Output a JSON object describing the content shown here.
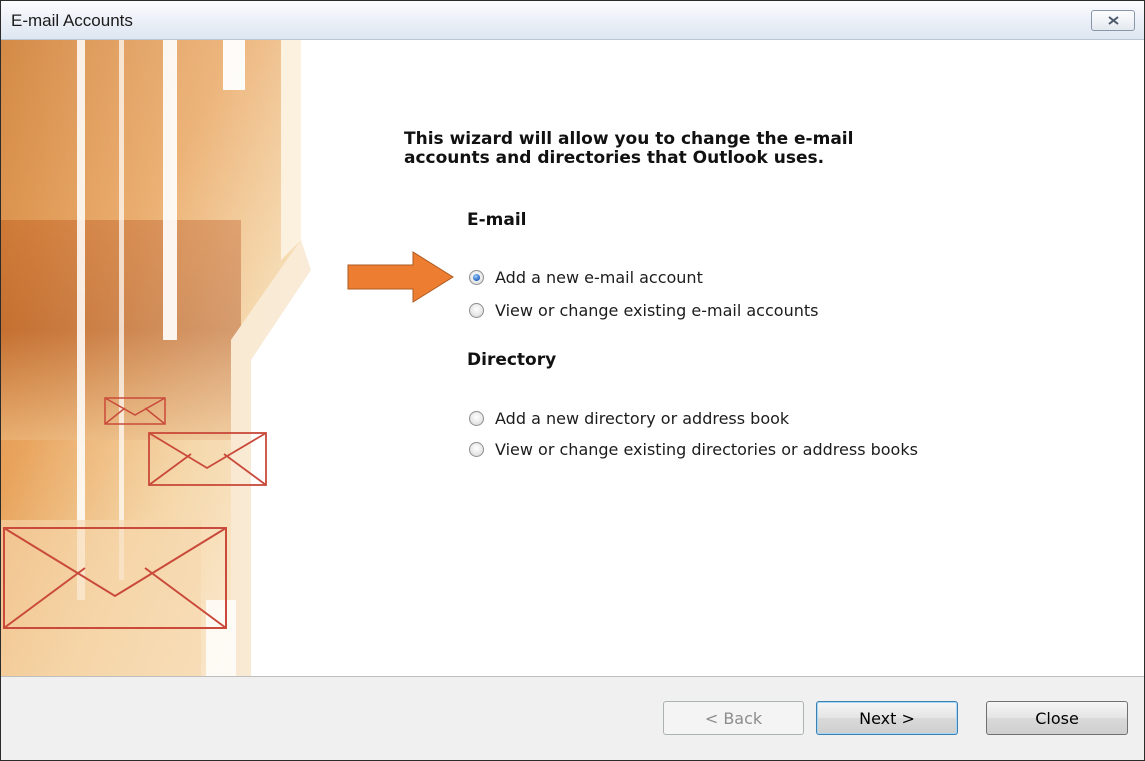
{
  "window": {
    "title": "E-mail Accounts"
  },
  "intro": {
    "line1": "This wizard will allow you to change the e-mail",
    "line2": "accounts and directories that Outlook uses."
  },
  "email_section": {
    "heading": "E-mail",
    "options": [
      {
        "label": "Add a new e-mail account",
        "checked": true
      },
      {
        "label": "View or change existing e-mail accounts",
        "checked": false
      }
    ]
  },
  "directory_section": {
    "heading": "Directory",
    "options": [
      {
        "label": "Add a new directory or address book",
        "checked": false
      },
      {
        "label": "View or change existing directories or address books",
        "checked": false
      }
    ]
  },
  "buttons": {
    "back": "< Back",
    "next": "Next >",
    "close": "Close"
  },
  "colors": {
    "accent_arrow": "#ed7d31",
    "banner_orange": "#d8832f"
  },
  "icons": {
    "close": "close-x-icon",
    "pointer": "arrow-right-icon",
    "envelope": "envelope-icon"
  }
}
